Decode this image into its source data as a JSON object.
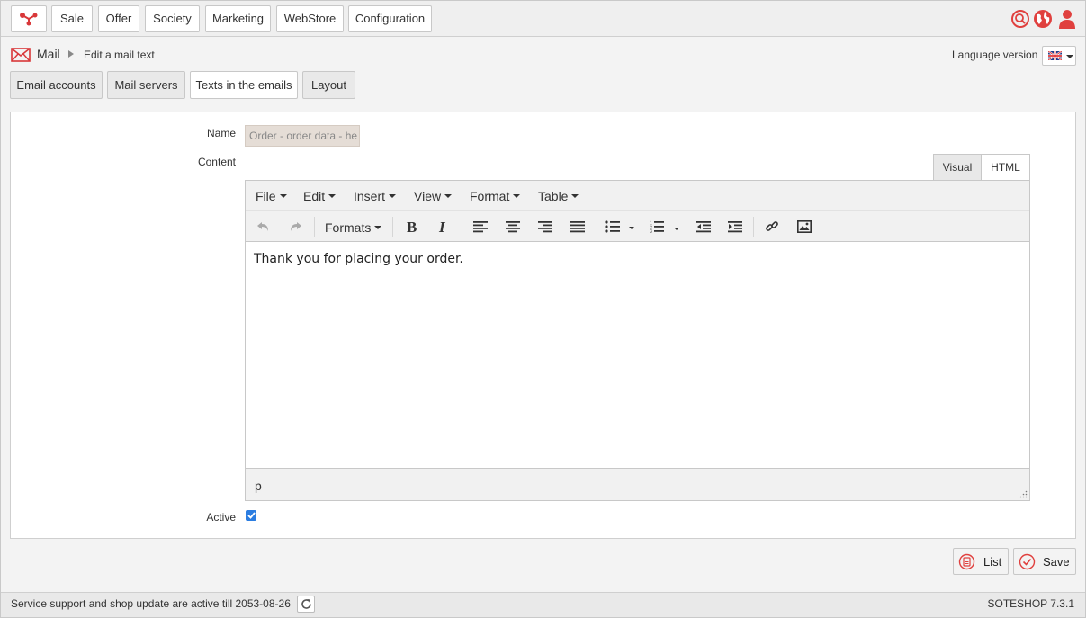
{
  "top_nav": {
    "items": [
      "Sale",
      "Offer",
      "Society",
      "Marketing",
      "WebStore",
      "Configuration"
    ]
  },
  "top_icons": {
    "search": "search-icon",
    "globe": "globe-icon",
    "user": "user-icon",
    "accent_color": "#e0403e"
  },
  "breadcrumb": {
    "section": "Mail",
    "current": "Edit a mail text"
  },
  "language": {
    "label": "Language version",
    "selected": "uk-flag-icon"
  },
  "tabs": [
    "Email accounts",
    "Mail servers",
    "Texts in the emails",
    "Layout"
  ],
  "active_tab": "Texts in the emails",
  "form": {
    "name_label": "Name",
    "name_value": "Order - order data - he",
    "content_label": "Content",
    "active_label": "Active",
    "active_checked": true
  },
  "editor": {
    "view_tabs": [
      "Visual",
      "HTML"
    ],
    "active_view": "HTML",
    "menu": [
      "File",
      "Edit",
      "Insert",
      "View",
      "Format",
      "Table"
    ],
    "formats_label": "Formats",
    "content": "Thank you for placing your order.",
    "path": "p"
  },
  "actions": {
    "list_label": "List",
    "save_label": "Save"
  },
  "footer": {
    "support_text": "Service support and shop update are active till 2053-08-26",
    "version": "SOTESHOP 7.3.1"
  },
  "colors": {
    "brand_red": "#e0403e",
    "checkbox_blue": "#2b7de1"
  }
}
